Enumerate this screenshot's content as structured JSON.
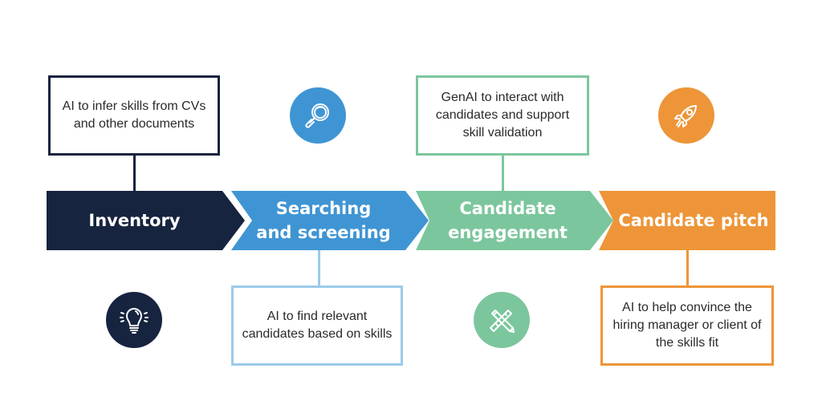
{
  "colors": {
    "inventory": "#17243f",
    "searching": "#3f95d3",
    "engagement": "#7cc69d",
    "pitch": "#ed9538",
    "searching_note_border": "#9ccaea",
    "text_dark": "#2a2a2a"
  },
  "stages": [
    {
      "key": "inventory",
      "label_lines": [
        "Inventory"
      ],
      "note": "AI to infer skills from CVs and other documents",
      "note_position": "top",
      "icon": "lightbulb-icon",
      "icon_position": "bottom"
    },
    {
      "key": "searching",
      "label_lines": [
        "Searching",
        "and screening"
      ],
      "note": "AI to find relevant candidates based on skills",
      "note_position": "bottom",
      "icon": "magnifying-glass-icon",
      "icon_position": "top"
    },
    {
      "key": "engagement",
      "label_lines": [
        "Candidate",
        "engagement"
      ],
      "note": "GenAI to interact with candidates and support skill validation",
      "note_position": "top",
      "icon": "pencil-ruler-icon",
      "icon_position": "bottom"
    },
    {
      "key": "pitch",
      "label_lines": [
        "Candidate pitch"
      ],
      "note": "AI to help convince the hiring manager or client of the skills fit",
      "note_position": "bottom",
      "icon": "rocket-icon",
      "icon_position": "top"
    }
  ]
}
